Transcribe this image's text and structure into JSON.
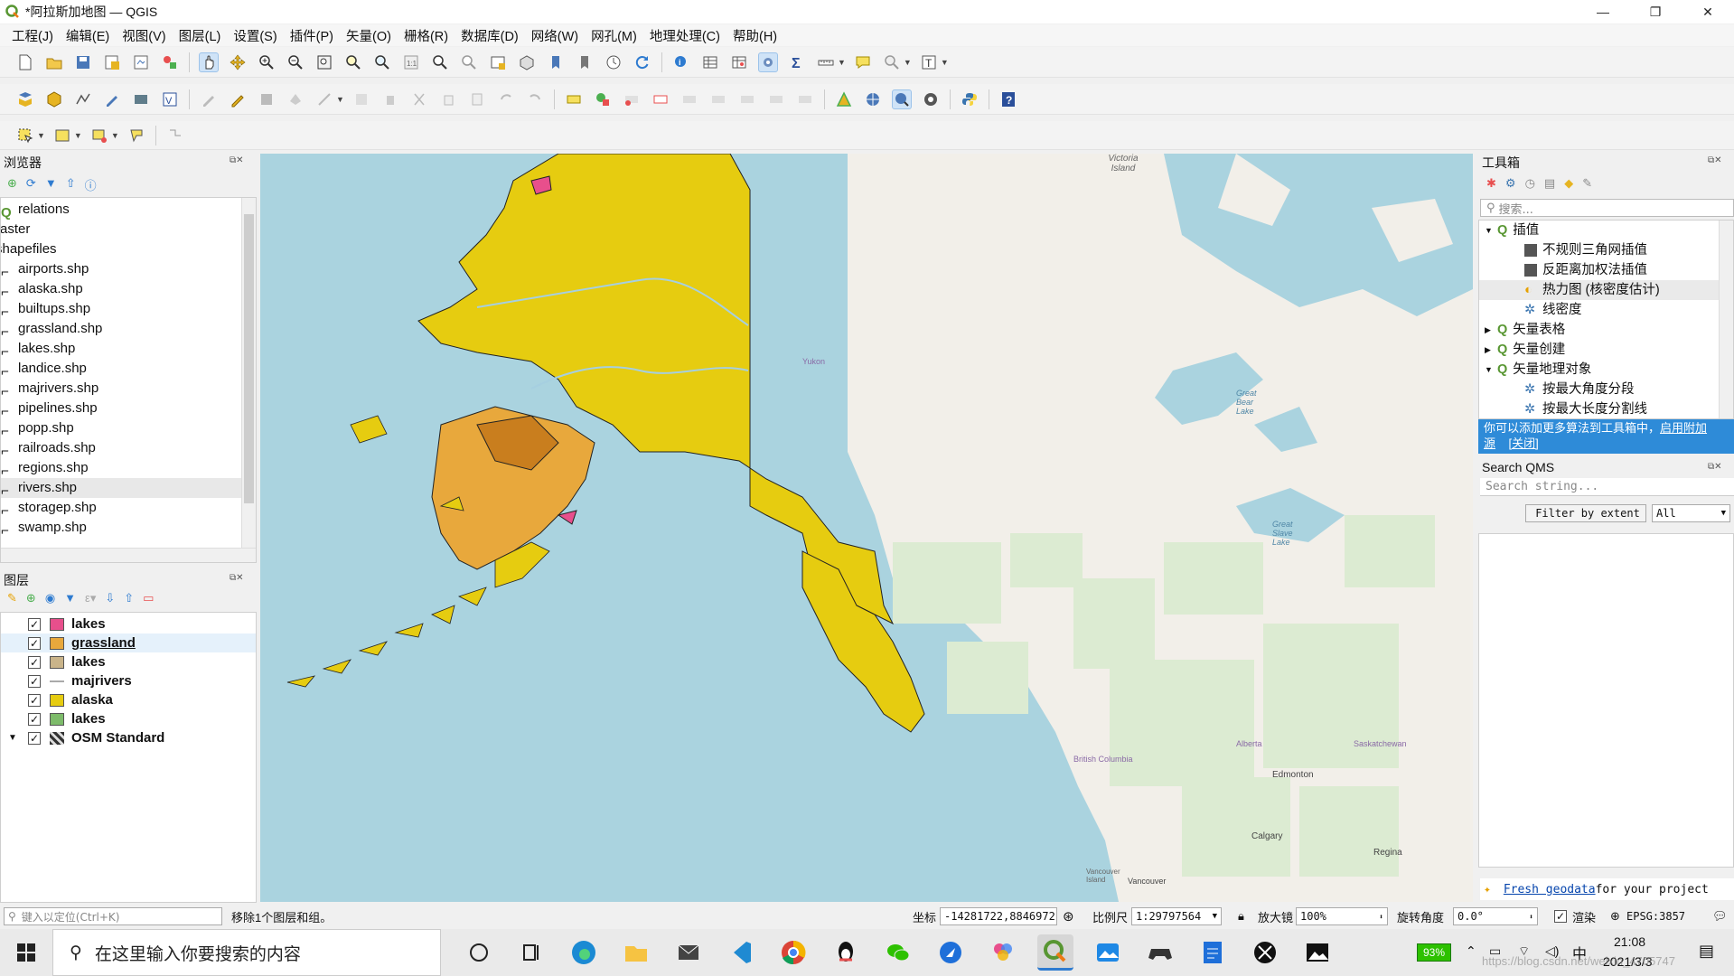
{
  "window": {
    "title": "*阿拉斯加地图 — QGIS",
    "min": "—",
    "max": "❐",
    "close": "✕"
  },
  "menu": [
    "工程(J)",
    "编辑(E)",
    "视图(V)",
    "图层(L)",
    "设置(S)",
    "插件(P)",
    "矢量(O)",
    "栅格(R)",
    "数据库(D)",
    "网络(W)",
    "网孔(M)",
    "地理处理(C)",
    "帮助(H)"
  ],
  "browser": {
    "title": "浏览器",
    "items": [
      "relations",
      "raster",
      "shapefiles",
      "airports.shp",
      "alaska.shp",
      "builtups.shp",
      "grassland.shp",
      "lakes.shp",
      "landice.shp",
      "majrivers.shp",
      "pipelines.shp",
      "popp.shp",
      "railroads.shp",
      "regions.shp",
      "rivers.shp",
      "storagep.shp",
      "swamp.shp"
    ]
  },
  "layers": {
    "title": "图层",
    "items": [
      {
        "name": "lakes",
        "color": "#e84f8c",
        "checked": true
      },
      {
        "name": "grassland",
        "color": "#e8a83c",
        "checked": true
      },
      {
        "name": "lakes",
        "color": "#c9b48a",
        "checked": true
      },
      {
        "name": "majrivers",
        "color": "#aaaaaa",
        "checked": true
      },
      {
        "name": "alaska",
        "color": "#e6cc10",
        "checked": true
      },
      {
        "name": "lakes",
        "color": "#7dbb6a",
        "checked": true
      },
      {
        "name": "OSM Standard",
        "color": "#555555",
        "checked": true
      }
    ]
  },
  "map": {
    "labels": [
      "Victoria Island",
      "Yukon",
      "Great Slave Lake",
      "British Columbia",
      "Alberta",
      "Saskatchewan",
      "Edmonton",
      "Calgary",
      "Regina",
      "Vancouver Island",
      "Vancouver",
      "Great Bear Lake"
    ]
  },
  "toolbox": {
    "title": "工具箱",
    "search_placeholder": "搜索...",
    "items": [
      {
        "label": "插值",
        "level": 0,
        "expanded": true
      },
      {
        "label": "不规则三角网插值",
        "level": 1
      },
      {
        "label": "反距离加权法插值",
        "level": 1
      },
      {
        "label": "热力图 (核密度估计)",
        "level": 1
      },
      {
        "label": "线密度",
        "level": 1
      },
      {
        "label": "矢量表格",
        "level": 0,
        "expanded": false
      },
      {
        "label": "矢量创建",
        "level": 0,
        "expanded": false
      },
      {
        "label": "矢量地理对象",
        "level": 0,
        "expanded": true
      },
      {
        "label": "按最大角度分段",
        "level": 1
      },
      {
        "label": "按最大长度分割线",
        "level": 1
      }
    ],
    "info_text": "你可以添加更多算法到工具箱中，",
    "info_link": "启用附加源",
    "info_close": "[关闭]"
  },
  "qms": {
    "title": "Search QMS",
    "search_placeholder": "Search string...",
    "filter_btn": "Filter by extent",
    "filter_value": "All",
    "footer_link": "Fresh geodata",
    "footer_text": " for your project"
  },
  "status": {
    "locate_placeholder": "键入以定位(Ctrl+K)",
    "message": "移除1个图层和组。",
    "coord_label": "坐标",
    "coord_value": "-14281722,8846972",
    "scale_label": "比例尺",
    "scale_value": "1:29797564",
    "magnifier_label": "放大镜",
    "magnifier_value": "100%",
    "rotation_label": "旋转角度",
    "rotation_value": "0.0°",
    "render_label": "渲染",
    "crs": "EPSG:3857"
  },
  "taskbar": {
    "search_placeholder": "在这里输入你要搜索的内容",
    "battery": "93%",
    "ime": "中",
    "time": "21:08",
    "date": "2021/3/3",
    "watermark": "https://blog.csdn.net/weixin_4705747"
  }
}
